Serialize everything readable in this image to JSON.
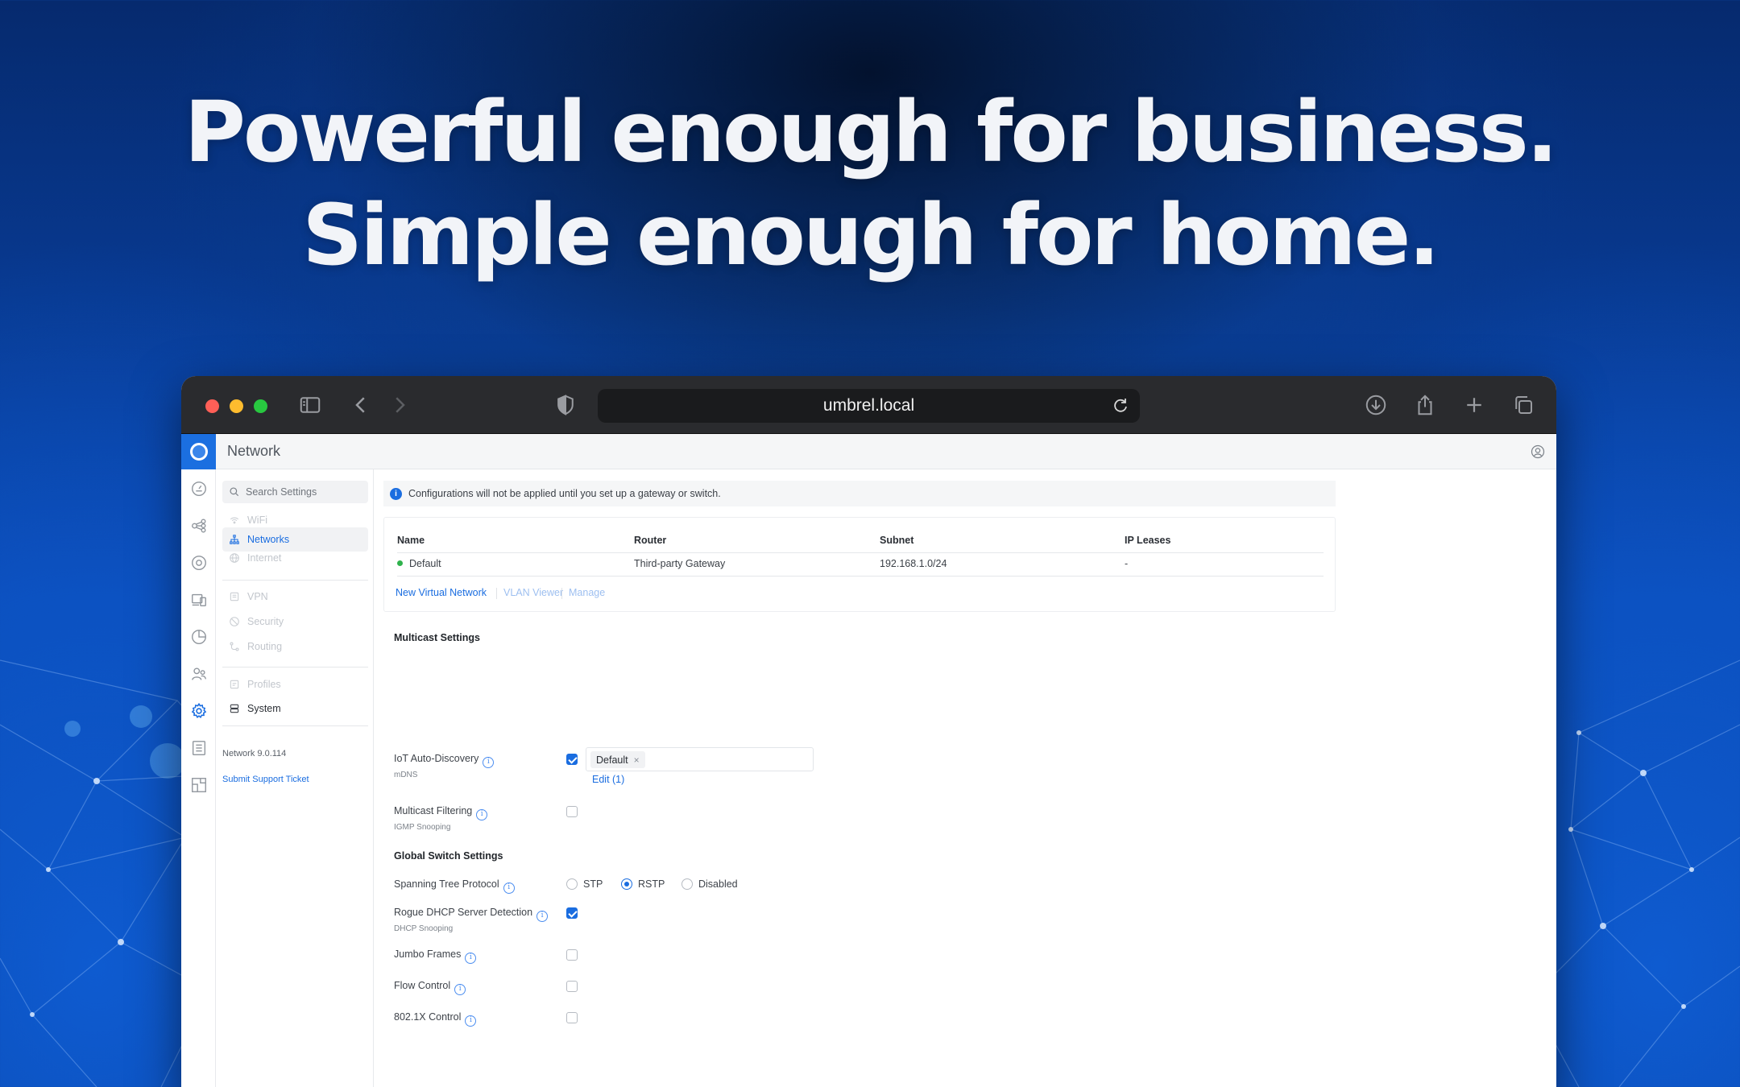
{
  "hero": {
    "line1": "Powerful enough for business.",
    "line2": "Simple enough for home."
  },
  "browser": {
    "url": "umbrel.local",
    "traffic_lights": {
      "close": "#ff5f57",
      "minimize": "#febc2e",
      "zoom": "#28c840"
    },
    "toolbar_icons": [
      "sidebar-icon",
      "back-icon",
      "forward-icon",
      "shield-icon",
      "reload-icon",
      "download-icon",
      "share-icon",
      "new-tab-icon",
      "tabs-icon"
    ]
  },
  "app": {
    "title": "Network",
    "accent": "#1a6de0",
    "rail_icons": [
      "dashboard-icon",
      "topology-icon",
      "devices-icon",
      "clients-icon",
      "insights-icon",
      "users-icon",
      "settings-icon",
      "logs-icon",
      "floorplan-icon"
    ]
  },
  "nav": {
    "search_placeholder": "Search Settings",
    "items": [
      {
        "label": "WiFi",
        "icon": "wifi-icon",
        "state": "disabled"
      },
      {
        "label": "Networks",
        "icon": "networks-icon",
        "state": "active"
      },
      {
        "label": "Internet",
        "icon": "globe-icon",
        "state": "disabled"
      },
      {
        "label": "VPN",
        "icon": "vpn-icon",
        "state": "disabled"
      },
      {
        "label": "Security",
        "icon": "security-icon",
        "state": "disabled"
      },
      {
        "label": "Routing",
        "icon": "routing-icon",
        "state": "disabled"
      },
      {
        "label": "Profiles",
        "icon": "profiles-icon",
        "state": "disabled"
      },
      {
        "label": "System",
        "icon": "system-icon",
        "state": "normal"
      }
    ],
    "version": "Network 9.0.114",
    "support": "Submit Support Ticket"
  },
  "main": {
    "notice": "Configurations will not be applied until you set up a gateway or switch.",
    "table": {
      "columns": [
        "Name",
        "Router",
        "Subnet",
        "IP Leases"
      ],
      "rows": [
        {
          "name": "Default",
          "router": "Third-party Gateway",
          "subnet": "192.168.1.0/24",
          "leases": "-"
        }
      ]
    },
    "links": {
      "new_virtual_network": "New Virtual Network",
      "vlan_viewer": "VLAN Viewer",
      "manage": "Manage"
    },
    "multicast": {
      "title": "Multicast Settings",
      "iot": {
        "label": "IoT Auto-Discovery",
        "sub": "mDNS",
        "checked": true,
        "tag": "Default",
        "tag_remove": "×",
        "edit": "Edit (1)"
      },
      "filtering": {
        "label": "Multicast Filtering",
        "sub": "IGMP Snooping",
        "checked": false
      }
    },
    "global_switch": {
      "title": "Global Switch Settings",
      "stp": {
        "label": "Spanning Tree Protocol",
        "options": [
          "STP",
          "RSTP",
          "Disabled"
        ],
        "selected": "RSTP"
      },
      "rogue_dhcp": {
        "label": "Rogue DHCP Server Detection",
        "sub": "DHCP Snooping",
        "checked": true
      },
      "jumbo": {
        "label": "Jumbo Frames",
        "checked": false
      },
      "flow": {
        "label": "Flow Control",
        "checked": false
      },
      "dot1x": {
        "label": "802.1X Control",
        "checked": false
      }
    }
  }
}
